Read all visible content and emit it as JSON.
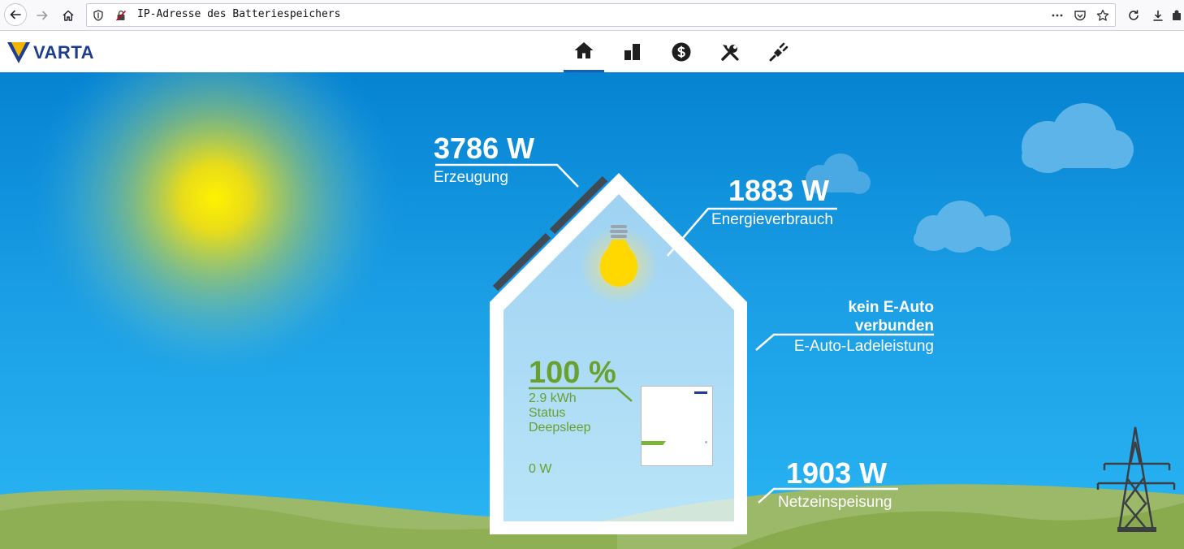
{
  "browser": {
    "url": "IP-Adresse des Batteriespeichers",
    "icons": [
      "back-arrow-icon",
      "forward-arrow-icon",
      "home-icon",
      "shield-icon",
      "insecure-lock-icon",
      "more-icon",
      "pocket-icon",
      "bookmark-star-icon",
      "reload-icon",
      "download-icon",
      "extension-icon"
    ]
  },
  "header": {
    "logo": "VARTA",
    "tabs": [
      {
        "icon": "home-icon",
        "active": true
      },
      {
        "icon": "bar-chart-icon",
        "active": false
      },
      {
        "icon": "dollar-icon",
        "active": false
      },
      {
        "icon": "tools-icon",
        "active": false
      },
      {
        "icon": "plug-icon",
        "active": false
      }
    ]
  },
  "colors": {
    "sky_top": "#0583d2",
    "sky_bottom": "#2ab6f4",
    "green_text": "#6aa02d",
    "brand_blue": "#1d3e8f",
    "brand_yellow": "#f2b600"
  },
  "scene": {
    "production": {
      "value": "3786 W",
      "label": "Erzeugung"
    },
    "consumption": {
      "value": "1883 W",
      "label": "Energieverbrauch"
    },
    "ev": {
      "line1": "kein E-Auto",
      "line2": "verbunden",
      "label": "E-Auto-Ladeleistung"
    },
    "grid": {
      "value": "1903 W",
      "label": "Netzeinspeisung"
    },
    "battery": {
      "soc": "100 %",
      "capacity": "2.9 kWh",
      "status_label": "Status",
      "status_value": "Deepsleep",
      "power": "0 W"
    }
  }
}
